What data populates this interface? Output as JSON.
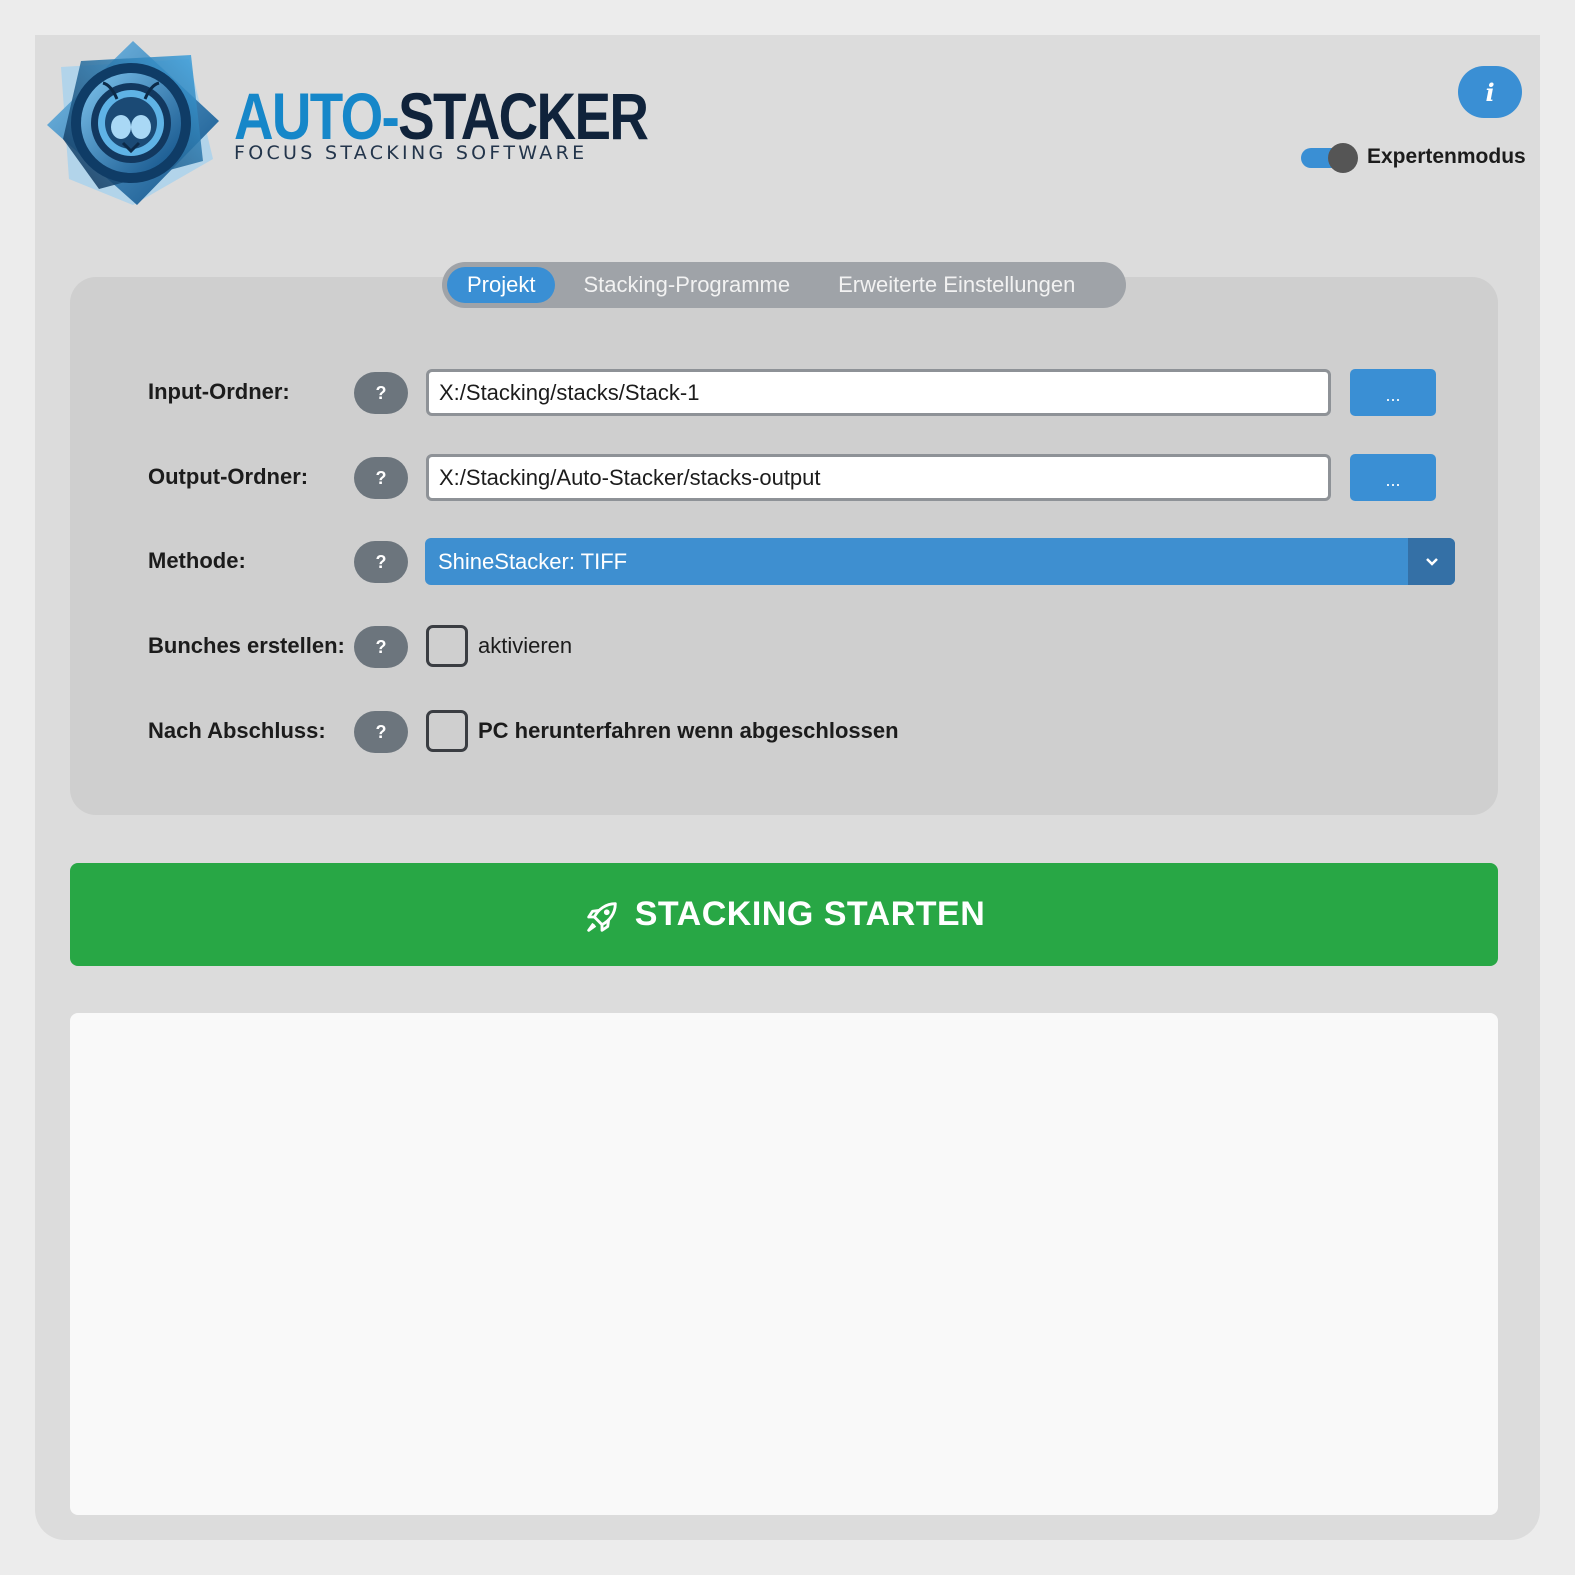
{
  "app": {
    "logo_title_part1": "AUTO-",
    "logo_title_part2": "STACKER",
    "logo_subtitle": "FOCUS STACKING SOFTWARE",
    "info_label": "i",
    "expert_mode_label": "Expertenmodus",
    "expert_mode_on": true
  },
  "tabs": [
    {
      "label": "Projekt",
      "active": true
    },
    {
      "label": "Stacking-Programme",
      "active": false
    },
    {
      "label": "Erweiterte Einstellungen",
      "active": false
    }
  ],
  "form": {
    "help_label": "?",
    "browse_label": "...",
    "input_folder": {
      "label": "Input-Ordner:",
      "value": "X:/Stacking/stacks/Stack-1"
    },
    "output_folder": {
      "label": "Output-Ordner:",
      "value": "X:/Stacking/Auto-Stacker/stacks-output"
    },
    "method": {
      "label": "Methode:",
      "value": "ShineStacker: TIFF"
    },
    "bunches": {
      "label": "Bunches erstellen:",
      "checkbox_label": "aktivieren",
      "checked": false
    },
    "after": {
      "label": "Nach Abschluss:",
      "checkbox_label": "PC herunterfahren wenn abgeschlossen",
      "checked": false
    }
  },
  "start_button": {
    "label": "STACKING STARTEN",
    "icon": "rocket-icon"
  },
  "log": {
    "text": ""
  },
  "colors": {
    "accent": "#3a8fd4",
    "start": "#28a745",
    "help": "#6c757d",
    "brand_light": "#1687c9",
    "brand_dark": "#10233b"
  }
}
